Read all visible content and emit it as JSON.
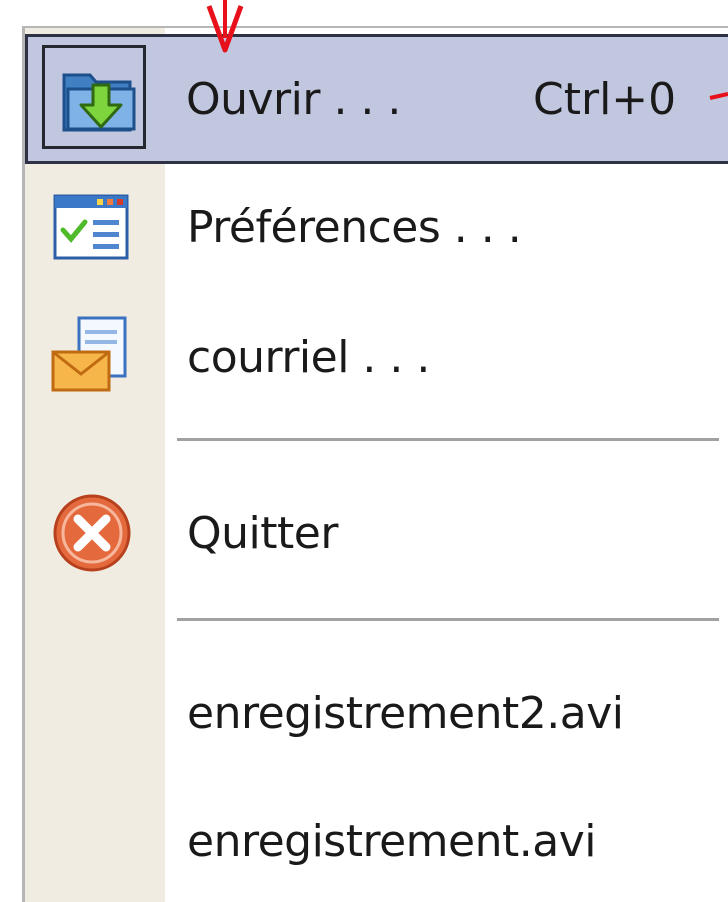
{
  "menu": {
    "items": [
      {
        "label": "Ouvrir . . .",
        "shortcut": "Ctrl+0",
        "icon": "open-folder-icon",
        "highlighted": true
      },
      {
        "label": "Préférences . . .",
        "icon": "preferences-icon"
      },
      {
        "label": "courriel . . .",
        "icon": "email-icon"
      },
      {
        "label": "Quitter",
        "icon": "quit-icon"
      },
      {
        "label": "enregistrement2.avi"
      },
      {
        "label": "enregistrement.avi"
      }
    ]
  },
  "colors": {
    "highlight_background": "#c2c7e0",
    "highlight_border": "#2f3144",
    "gutter": "#f1ece2",
    "annotation_arrow": "#e8101a"
  }
}
